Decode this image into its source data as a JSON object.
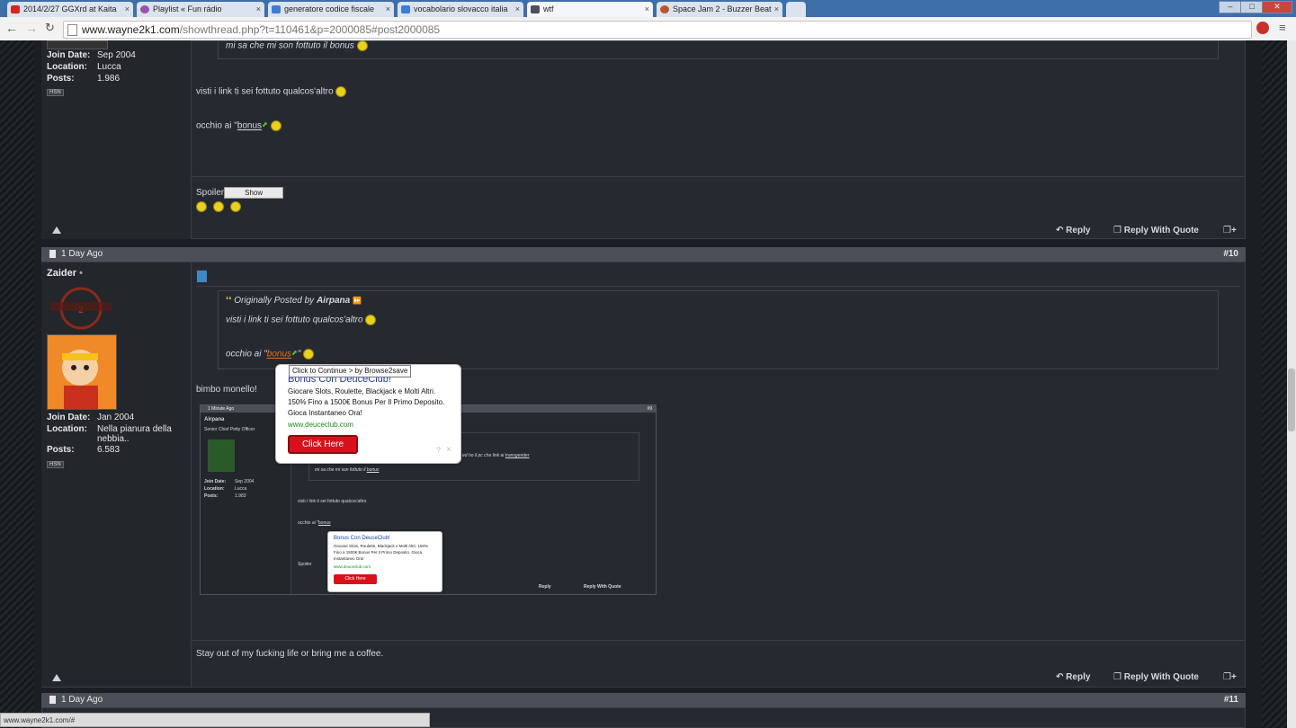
{
  "browser": {
    "tabs": [
      {
        "label": "2014/2/27 GGXrd at Kaita",
        "color": "#d7261b"
      },
      {
        "label": "Playlist « Fun rádio",
        "color": "#9b4fb0"
      },
      {
        "label": "generatore codice fiscale",
        "color": "#3f7bd8"
      },
      {
        "label": "vocabolario slovacco italia",
        "color": "#3f7bd8"
      },
      {
        "label": "wtf",
        "color": "#4a4f5a"
      },
      {
        "label": "Space Jam 2 - Buzzer Beat",
        "color": "#b8572a"
      }
    ],
    "tab_close": "×",
    "url_host": "www.wayne2k1.com",
    "url_path": "/showthread.php?t=110461&p=2000085#post2000085",
    "status_url": "www.wayne2k1.com/#"
  },
  "post9": {
    "join_label": "Join Date:",
    "join_value": "Sep 2004",
    "location_label": "Location:",
    "location_value": "Lucca",
    "posts_label": "Posts:",
    "posts_value": "1.986",
    "badge": "HSN",
    "quote_tail": "mi sa che mi son fottuto il bonus",
    "line1": "visti i link ti sei fottuto qualcos'altro",
    "line2_pre": "occhio ai \"",
    "line2_link": "bonus",
    "spoiler_label": "Spoiler",
    "show_button": "Show",
    "reply": "Reply",
    "reply_quote": "Reply With Quote"
  },
  "post10": {
    "date": "1 Day Ago",
    "number": "#10",
    "username": "Zaider",
    "join_label": "Join Date:",
    "join_value": "Jan 2004",
    "location_label": "Location:",
    "location_value": "Nella pianura della nebbia..",
    "posts_label": "Posts:",
    "posts_value": "6.583",
    "badge": "HSN",
    "quote_prefix": "Originally Posted by",
    "quote_author": "Airpana",
    "quote_line1": "visti i link ti sei fottuto qualcos'altro",
    "quote_line2_pre": "occhio ai \"",
    "quote_line2_link": "bonus",
    "quote_line2_post": "\"",
    "message": "bimbo monello!",
    "signature": "Stay out of my fucking life or bring me a coffee.",
    "reply": "Reply",
    "reply_quote": "Reply With Quote"
  },
  "ad": {
    "tooltip": "Click to Continue > by Browse2save",
    "title": "Bonus Con DeuceClub!",
    "body": "Giocare Slots, Roulette, Blackjack e Molti Altri. 150% Fino a 1500€ Bonus Per Il Primo Deposito. Gioca Instantaneo Ora!",
    "url": "www.deuceclub.com",
    "button": "Click Here",
    "help": "?",
    "close": "×"
  },
  "screenshot_inner": {
    "date": "1 Minute Ago",
    "number": "#9",
    "username": "Airpana",
    "rank": "Senior Chief Petty Officer",
    "join_label": "Join Date:",
    "join_value": "Sep 2004",
    "location_label": "Location:",
    "location_value": "Lucca",
    "posts_label": "Posts:",
    "posts_value": "1.983",
    "quote_fragment": "ed ho il pc che link ai",
    "quote_fragment_link": "transgender",
    "quote_tail": "mi sa che mi son fottuto il",
    "quote_tail_link": "bonus",
    "line1": "visti i link ti sei fottuto qualcos'altro",
    "line2_pre": "occhio ai \"",
    "line2_link": "bonus",
    "spoiler_label": "Spoiler",
    "reply": "Reply",
    "reply_quote": "Reply With Quote"
  },
  "post11": {
    "date": "1 Day Ago",
    "number": "#11"
  }
}
